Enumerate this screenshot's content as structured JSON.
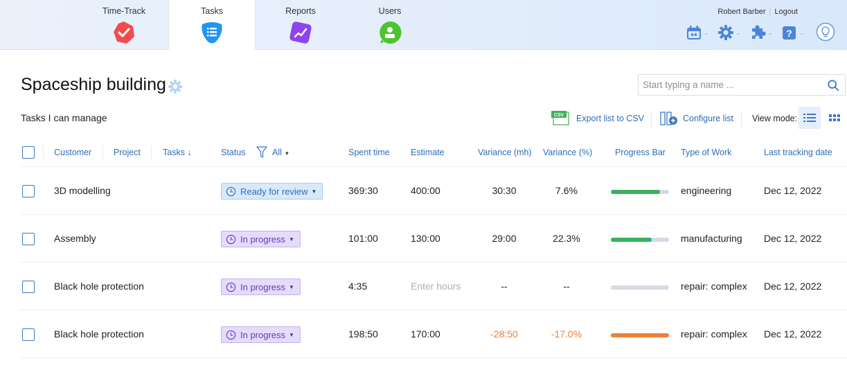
{
  "nav": {
    "tabs": [
      {
        "label": "Time-Track",
        "icon": "time-track-check-icon",
        "color": "#f04e4e",
        "active": false
      },
      {
        "label": "Tasks",
        "icon": "tasks-list-icon",
        "color": "#2196f3",
        "active": true
      },
      {
        "label": "Reports",
        "icon": "reports-chart-icon",
        "color": "#8e44ec",
        "active": false
      },
      {
        "label": "Users",
        "icon": "users-person-icon",
        "color": "#4cc42f",
        "active": false
      }
    ],
    "user_name": "Robert Barber",
    "logout_label": "Logout",
    "tools": [
      "calendar-icon",
      "gear-icon",
      "puzzle-icon",
      "help-icon",
      "lightbulb-icon"
    ]
  },
  "page": {
    "title": "Spaceship building",
    "subtitle": "Tasks I can manage",
    "search_placeholder": "Start typing a name ...",
    "search_value": "",
    "export_label": "Export list to CSV",
    "csv_badge": "CSV",
    "configure_label": "Configure list",
    "view_mode_label": "View mode:",
    "view_mode_active": "list"
  },
  "table": {
    "headers": {
      "customer": "Customer",
      "project": "Project",
      "tasks": "Tasks",
      "tasks_sort": "↓",
      "status": "Status",
      "status_filter": "All",
      "spent": "Spent time",
      "estimate": "Estimate",
      "variance_mh": "Variance (mh)",
      "variance_pct": "Variance (%)",
      "progress": "Progress Bar",
      "type": "Type of Work",
      "last_date": "Last tracking date"
    },
    "rows": [
      {
        "task": "3D modelling",
        "status": "Ready for review",
        "status_kind": "review",
        "spent": "369:30",
        "estimate": "400:00",
        "variance_mh": "30:30",
        "variance_pct": "7.6%",
        "negative": false,
        "progress": 0.85,
        "progress_color": "#3bb15f",
        "type": "engineering",
        "last_date": "Dec 12, 2022"
      },
      {
        "task": "Assembly",
        "status": "In progress",
        "status_kind": "progress",
        "spent": "101:00",
        "estimate": "130:00",
        "variance_mh": "29:00",
        "variance_pct": "22.3%",
        "negative": false,
        "progress": 0.7,
        "progress_color": "#3bb15f",
        "type": "manufacturing",
        "last_date": "Dec 12, 2022"
      },
      {
        "task": "Black hole protection",
        "status": "In progress",
        "status_kind": "progress",
        "spent": "4:35",
        "estimate": "Enter hours",
        "estimate_placeholder": true,
        "variance_mh": "--",
        "variance_pct": "--",
        "negative": false,
        "progress": 0,
        "progress_color": "#3bb15f",
        "type": "repair: complex",
        "last_date": "Dec 12, 2022"
      },
      {
        "task": "Black hole protection",
        "status": "In progress",
        "status_kind": "progress",
        "spent": "198:50",
        "estimate": "170:00",
        "variance_mh": "-28:50",
        "variance_pct": "-17.0%",
        "negative": true,
        "progress": 1.0,
        "progress_color": "#ee8038",
        "type": "repair: complex",
        "last_date": "Dec 12, 2022"
      }
    ]
  }
}
